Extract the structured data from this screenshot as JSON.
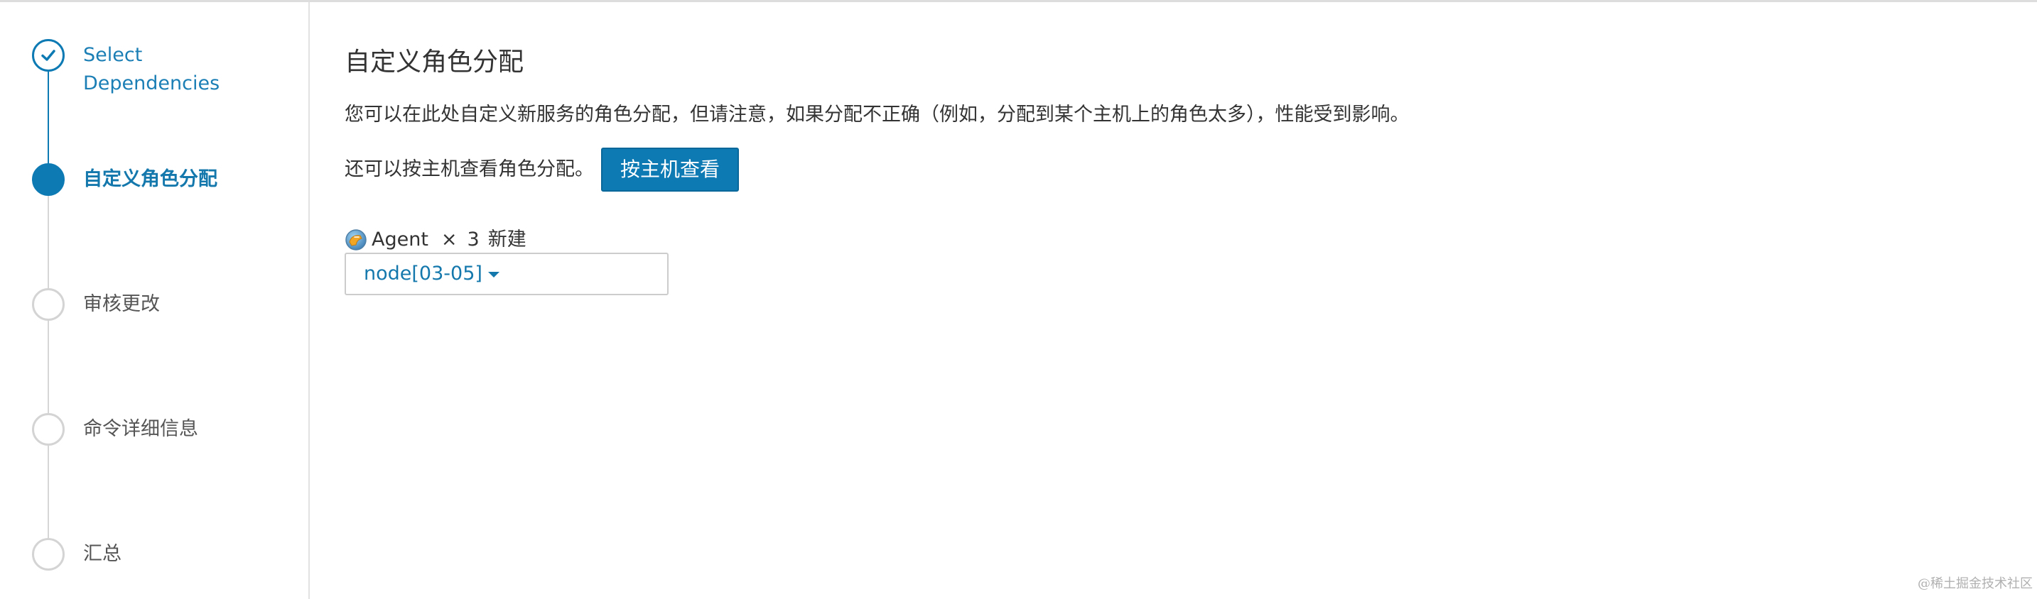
{
  "wizard": {
    "steps": [
      {
        "label": "Select\nDependencies",
        "state": "completed"
      },
      {
        "label": "自定义角色分配",
        "state": "current"
      },
      {
        "label": "审核更改",
        "state": "pending"
      },
      {
        "label": "命令详细信息",
        "state": "pending"
      },
      {
        "label": "汇总",
        "state": "pending"
      }
    ]
  },
  "main": {
    "title": "自定义角色分配",
    "description": "您可以在此处自定义新服务的角色分配，但请注意，如果分配不正确（例如，分配到某个主机上的角色太多），性能受到影响。",
    "host_view_text": "还可以按主机查看角色分配。",
    "host_view_button": "按主机查看",
    "role": {
      "icon": "agent-role-icon",
      "name": "Agent",
      "times": "×",
      "count": "3",
      "status": "新建",
      "hosts_value": "node[03-05]"
    }
  },
  "watermark": "@稀土掘金技术社区",
  "colors": {
    "accent": "#0d7ab4",
    "link": "#1478ad",
    "pending": "#d4d4d4",
    "text": "#333333"
  }
}
